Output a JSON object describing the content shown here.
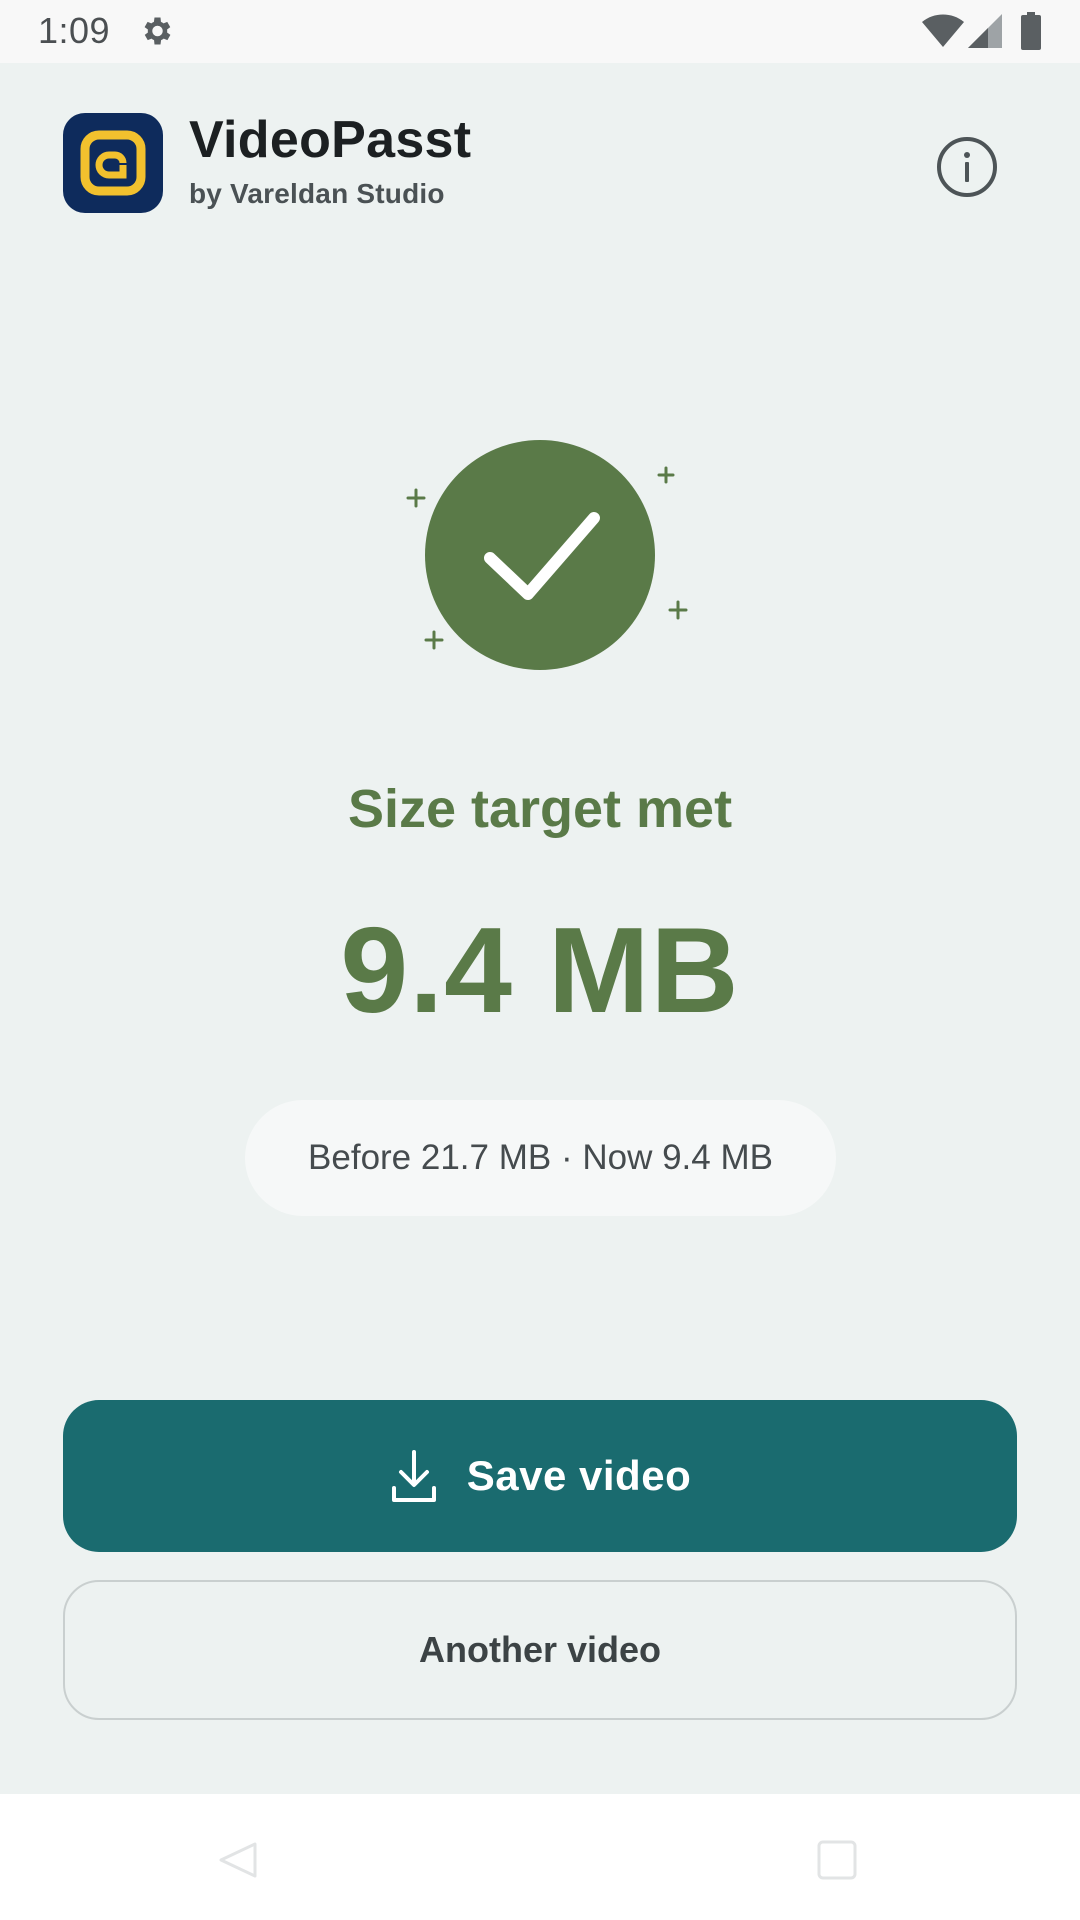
{
  "status_bar": {
    "time": "1:09",
    "icons": [
      "gear-icon",
      "wifi-icon",
      "signal-icon",
      "battery-icon"
    ]
  },
  "header": {
    "app_name": "VideoPasst",
    "developer": "by Vareldan Studio",
    "info_icon": "info-icon"
  },
  "result": {
    "status_icon": "check-circle-icon",
    "title": "Size target met",
    "size": "9.4 MB",
    "comparison": "Before 21.7 MB · Now 9.4 MB"
  },
  "actions": {
    "save_label": "Save video",
    "save_icon": "download-icon",
    "another_label": "Another video"
  },
  "nav_bar": {
    "icons": [
      "back-icon",
      "home-icon"
    ]
  },
  "colors": {
    "background": "#edf2f1",
    "success_green": "#5a7a48",
    "primary_teal": "#1a6b6f",
    "app_icon_navy": "#0e2b5c",
    "app_icon_yellow": "#f2c12e"
  }
}
